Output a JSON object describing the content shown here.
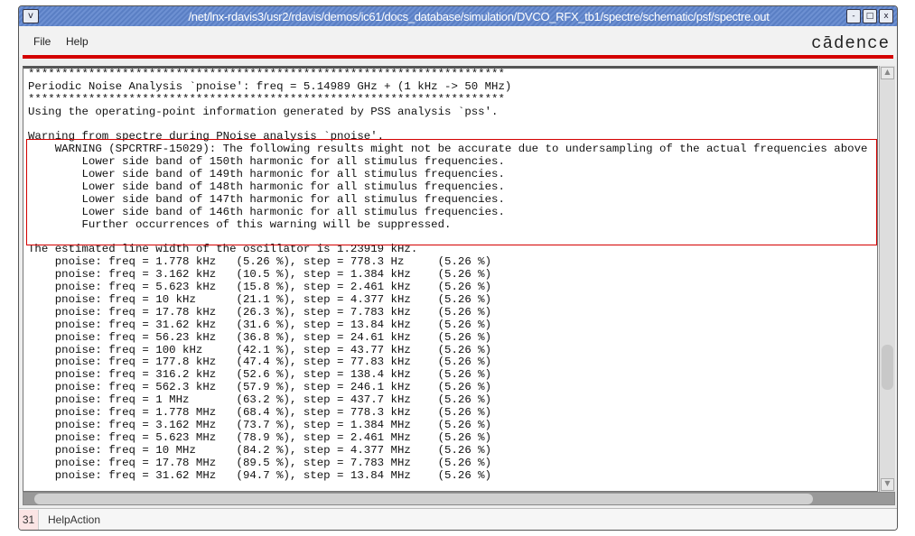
{
  "window": {
    "title": "/net/lnx-rdavis3/usr2/rdavis/demos/ic61/docs_database/simulation/DVCO_RFX_tb1/spectre/schematic/psf/spectre.out",
    "menu_icon": "v",
    "minimize": "-",
    "maximize": "□",
    "close": "x"
  },
  "menu": {
    "file": "File",
    "help": "Help",
    "logo": "cādence"
  },
  "log": {
    "header": [
      "***********************************************************************",
      "Periodic Noise Analysis `pnoise': freq = 5.14989 GHz + (1 kHz -> 50 MHz)",
      "***********************************************************************",
      "Using the operating-point information generated by PSS analysis `pss'.",
      ""
    ],
    "warning": [
      "Warning from spectre during PNoise analysis `pnoise'.",
      "    WARNING (SPCRTRF-15029): The following results might not be accurate due to undersampling of the actual frequencies above",
      "        Lower side band of 150th harmonic for all stimulus frequencies.",
      "        Lower side band of 149th harmonic for all stimulus frequencies.",
      "        Lower side band of 148th harmonic for all stimulus frequencies.",
      "        Lower side band of 147th harmonic for all stimulus frequencies.",
      "        Lower side band of 146th harmonic for all stimulus frequencies.",
      "        Further occurrences of this warning will be suppressed."
    ],
    "body": [
      "",
      "The estimated line width of the oscillator is 1.23919 kHz.",
      "    pnoise: freq = 1.778 kHz   (5.26 %), step = 778.3 Hz     (5.26 %)",
      "    pnoise: freq = 3.162 kHz   (10.5 %), step = 1.384 kHz    (5.26 %)",
      "    pnoise: freq = 5.623 kHz   (15.8 %), step = 2.461 kHz    (5.26 %)",
      "    pnoise: freq = 10 kHz      (21.1 %), step = 4.377 kHz    (5.26 %)",
      "    pnoise: freq = 17.78 kHz   (26.3 %), step = 7.783 kHz    (5.26 %)",
      "    pnoise: freq = 31.62 kHz   (31.6 %), step = 13.84 kHz    (5.26 %)",
      "    pnoise: freq = 56.23 kHz   (36.8 %), step = 24.61 kHz    (5.26 %)",
      "    pnoise: freq = 100 kHz     (42.1 %), step = 43.77 kHz    (5.26 %)",
      "    pnoise: freq = 177.8 kHz   (47.4 %), step = 77.83 kHz    (5.26 %)",
      "    pnoise: freq = 316.2 kHz   (52.6 %), step = 138.4 kHz    (5.26 %)",
      "    pnoise: freq = 562.3 kHz   (57.9 %), step = 246.1 kHz    (5.26 %)",
      "    pnoise: freq = 1 MHz       (63.2 %), step = 437.7 kHz    (5.26 %)",
      "    pnoise: freq = 1.778 MHz   (68.4 %), step = 778.3 kHz    (5.26 %)",
      "    pnoise: freq = 3.162 MHz   (73.7 %), step = 1.384 MHz    (5.26 %)",
      "    pnoise: freq = 5.623 MHz   (78.9 %), step = 2.461 MHz    (5.26 %)",
      "    pnoise: freq = 10 MHz      (84.2 %), step = 4.377 MHz    (5.26 %)",
      "    pnoise: freq = 17.78 MHz   (89.5 %), step = 7.783 MHz    (5.26 %)",
      "    pnoise: freq = 31.62 MHz   (94.7 %), step = 13.84 MHz    (5.26 %)"
    ]
  },
  "status": {
    "number": "31",
    "message": "HelpAction"
  }
}
